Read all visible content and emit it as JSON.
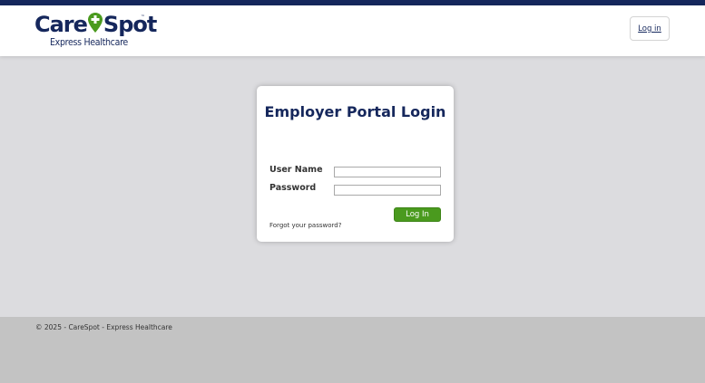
{
  "colors": {
    "brand_navy": "#15275c",
    "brand_green": "#4a9a1e",
    "page_bg": "#dcdcdf",
    "footer_bg": "#c3c3c3"
  },
  "header": {
    "logo": {
      "name_part1": "Care",
      "name_part2": "Spot",
      "tagline": "Express Healthcare",
      "icon": "location-pin-plus-icon"
    },
    "login_button": "Log in"
  },
  "login_card": {
    "title": "Employer Portal Login",
    "username_label": "User Name",
    "username_value": "",
    "password_label": "Password",
    "password_value": "",
    "submit_label": "Log In",
    "forgot_link": "Forgot your password?"
  },
  "footer": {
    "copyright": "© 2025 - CareSpot - Express Healthcare"
  }
}
